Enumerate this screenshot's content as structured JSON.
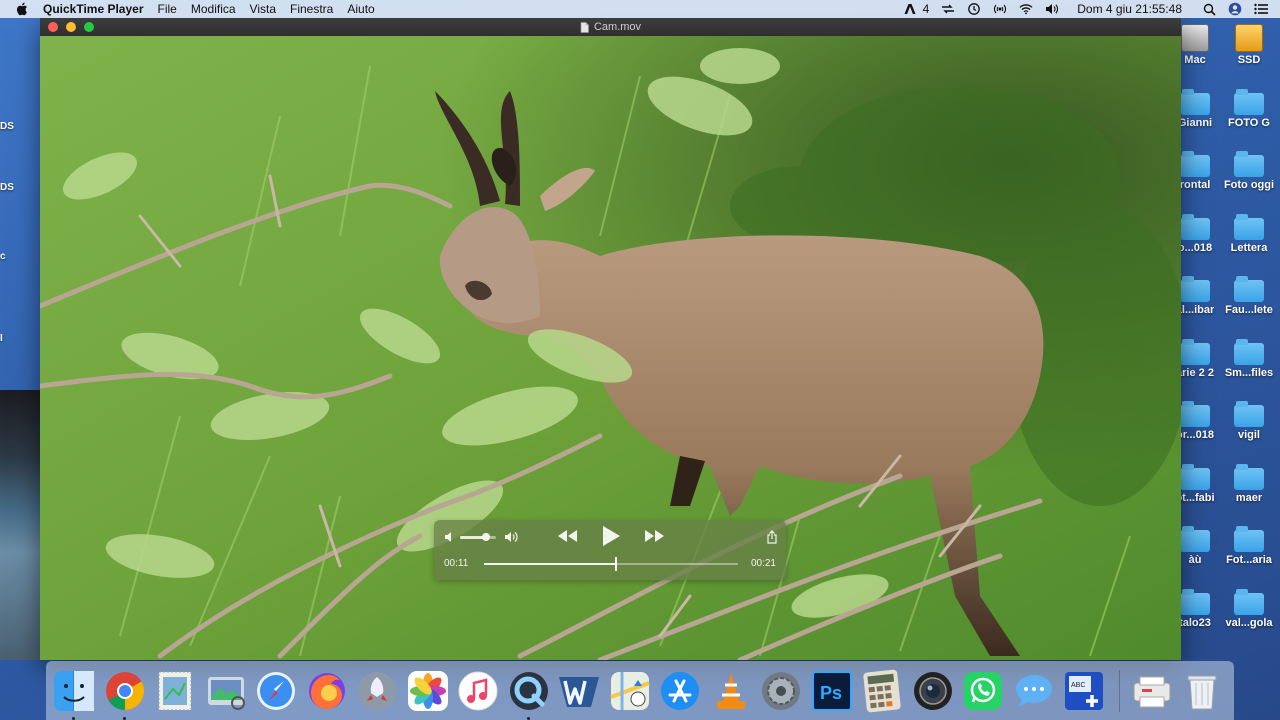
{
  "menubar": {
    "app_name": "QuickTime Player",
    "items": [
      "File",
      "Modifica",
      "Vista",
      "Finestra",
      "Aiuto"
    ],
    "status_count": "4",
    "datetime": "Dom 4 giu  21:55:48"
  },
  "window": {
    "title": "Cam.mov"
  },
  "player": {
    "current_time": "00:11",
    "duration": "00:21",
    "progress_fraction": 0.52,
    "volume_fraction": 0.72
  },
  "desktop": {
    "icons": [
      {
        "label": "Mac",
        "type": "drive-hd"
      },
      {
        "label": "SSD",
        "type": "drive-ssd"
      },
      {
        "label": "Gianni",
        "type": "folder"
      },
      {
        "label": "FOTO G",
        "type": "folder"
      },
      {
        "label": "rontal",
        "type": "folder"
      },
      {
        "label": "Foto oggi",
        "type": "folder"
      },
      {
        "label": "o...018",
        "type": "folder"
      },
      {
        "label": "Lettera",
        "type": "folder"
      },
      {
        "label": "al...ibar",
        "type": "folder"
      },
      {
        "label": "Fau...lete",
        "type": "folder"
      },
      {
        "label": "arie 2 2",
        "type": "folder"
      },
      {
        "label": "Sm...files",
        "type": "folder"
      },
      {
        "label": "or...018",
        "type": "folder"
      },
      {
        "label": "vigil",
        "type": "folder"
      },
      {
        "label": "ot...fabi",
        "type": "folder"
      },
      {
        "label": "maer",
        "type": "folder"
      },
      {
        "label": "àù",
        "type": "folder"
      },
      {
        "label": "Fot...aria",
        "type": "folder"
      },
      {
        "label": "talo23",
        "type": "folder"
      },
      {
        "label": "val...gola",
        "type": "folder"
      }
    ],
    "left_edge_labels": [
      "DS",
      "DS",
      "c",
      "I"
    ]
  },
  "dock": {
    "items": [
      {
        "name": "finder-icon",
        "running": true
      },
      {
        "name": "chrome-icon",
        "running": true
      },
      {
        "name": "mail-stamp-icon",
        "running": false
      },
      {
        "name": "preview-icon",
        "running": false
      },
      {
        "name": "safari-icon",
        "running": false
      },
      {
        "name": "firefox-icon",
        "running": false
      },
      {
        "name": "launchpad-icon",
        "running": false
      },
      {
        "name": "photos-icon",
        "running": false
      },
      {
        "name": "music-icon",
        "running": false
      },
      {
        "name": "quicktime-icon",
        "running": true
      },
      {
        "name": "word-icon",
        "running": false
      },
      {
        "name": "maps-icon",
        "running": false
      },
      {
        "name": "app-store-icon",
        "running": false
      },
      {
        "name": "vlc-icon",
        "running": false
      },
      {
        "name": "system-preferences-icon",
        "running": false
      },
      {
        "name": "photoshop-icon",
        "running": false
      },
      {
        "name": "calculator-icon",
        "running": false
      },
      {
        "name": "camera-lens-icon",
        "running": false
      },
      {
        "name": "whatsapp-icon",
        "running": false
      },
      {
        "name": "messages-icon",
        "running": false
      },
      {
        "name": "text-editor-plus-icon",
        "running": false
      },
      {
        "name": "printer-icon",
        "running": false
      },
      {
        "name": "trash-icon",
        "running": false
      }
    ]
  },
  "colors": {
    "menubar_bg": "#dee9f5",
    "hud_bg": "#688046",
    "close": "#ff5f57",
    "minimize": "#febc2e",
    "zoom": "#28c840"
  }
}
